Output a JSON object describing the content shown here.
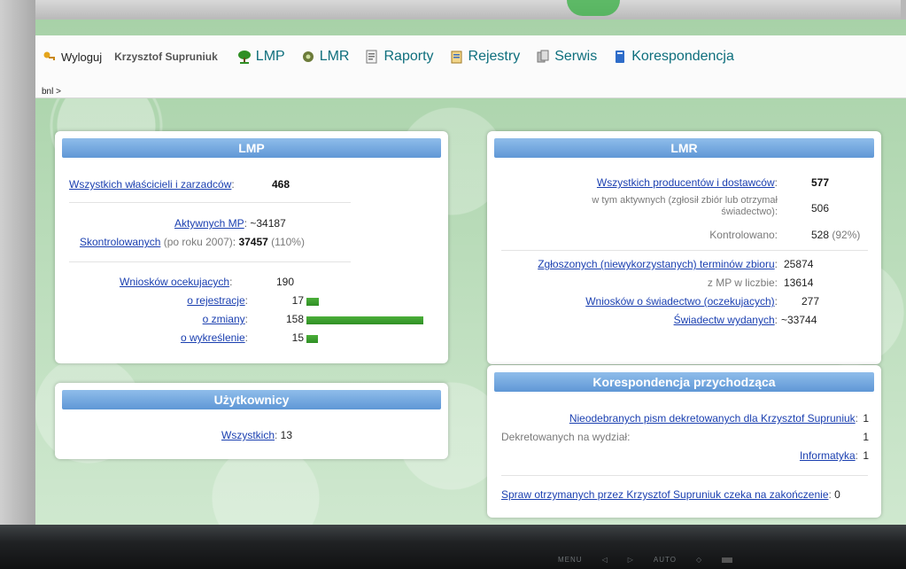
{
  "nav": {
    "logout": "Wyloguj",
    "user": "Krzysztof Supruniuk",
    "items": [
      {
        "label": "LMP",
        "icon": "tree-icon"
      },
      {
        "label": "LMR",
        "icon": "gear-leaf-icon"
      },
      {
        "label": "Raporty",
        "icon": "report-icon"
      },
      {
        "label": "Rejestry",
        "icon": "register-icon"
      },
      {
        "label": "Serwis",
        "icon": "service-icon"
      },
      {
        "label": "Korespondencja",
        "icon": "book-icon"
      }
    ]
  },
  "breadcrumb": "bnl >",
  "lmp": {
    "title": "LMP",
    "owners_label": "Wszystkich właścicieli i zarzadców",
    "owners_value": "468",
    "active_label": "Aktywnych MP",
    "active_value": "~34187",
    "checked_label": "Skontrolowanych",
    "checked_note": "(po roku 2007)",
    "checked_value": "37457",
    "checked_pct": "(110%)",
    "requests_label": "Wniosków ocekujacych",
    "requests_value": "190",
    "breakdown": [
      {
        "label": "o rejestracje",
        "value": 17
      },
      {
        "label": "o zmiany",
        "value": 158
      },
      {
        "label": "o wykreślenie",
        "value": 15
      }
    ]
  },
  "users": {
    "title": "Użytkownicy",
    "all_label": "Wszystkich",
    "all_value": "13"
  },
  "lmr": {
    "title": "LMR",
    "producers_label": "Wszystkich producentów i dostawców",
    "producers_value": "577",
    "active_label_1": "w tym aktywnych (zgłosił zbiór lub otrzymał",
    "active_label_2": "świadectwo):",
    "active_value": "506",
    "controlled_label": "Kontrolowano:",
    "controlled_value": "528",
    "controlled_pct": "(92%)",
    "terms_label": "Zgłoszonych (niewykorzystanych) terminów zbioru",
    "terms_value": "25874",
    "mp_label": "z MP w liczbie:",
    "mp_value": "13614",
    "cert_req_label": "Wniosków o świadectwo (oczekujacych)",
    "cert_req_value": "277",
    "cert_label": "Świadectw wydanych",
    "cert_value": "~33744"
  },
  "corr": {
    "title": "Korespondencja przychodząca",
    "undelivered_label": "Nieodebranych pism dekretowanych dla Krzysztof Supruniuk",
    "undelivered_value": "1",
    "dept_label": "Dekretowanych na wydział:",
    "dept_value": "1",
    "it_label": "Informatyka",
    "it_value": "1",
    "cases_label": "Spraw otrzymanych przez Krzysztof Supruniuk czeka na zakończenie",
    "cases_value": "0"
  },
  "bezel": [
    "MENU",
    "◁",
    "▷",
    "AUTO",
    "◇"
  ],
  "colors": {
    "accent": "#0e6f7d",
    "header_blue": "#6fa3dd",
    "bar_green": "#3aa02e",
    "link": "#1a3fb0"
  }
}
